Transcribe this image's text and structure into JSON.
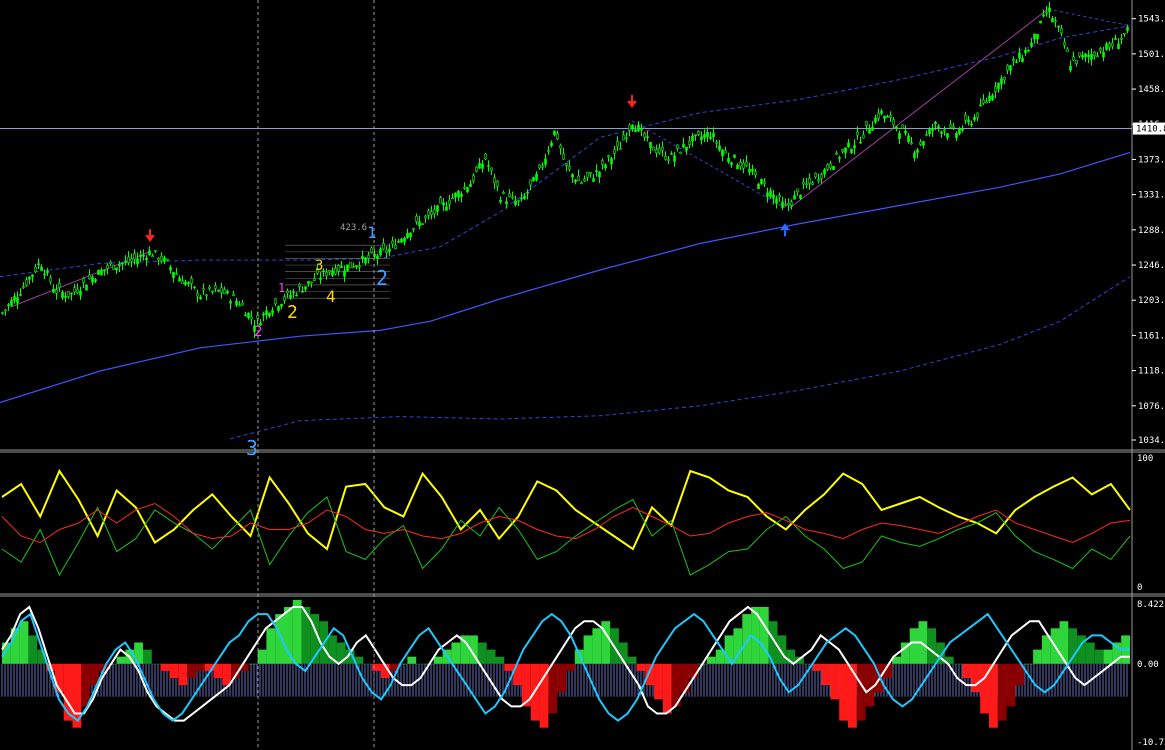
{
  "colors": {
    "background": "#000000",
    "candle_up": "#00ff00",
    "candle_down": "#00ff00",
    "ma_line": "#3a57ff",
    "band_dash": "#2f44d8",
    "hline": "#8aa0c8",
    "vline": "#9a9a9a",
    "stoch_yellow": "#ffff00",
    "stoch_green": "#19c41a",
    "stoch_red": "#ff2a1a",
    "hist_pos": "#2fd63b",
    "hist_pos_dark": "#0e8f1f",
    "hist_neg": "#ff1a1a",
    "hist_neg_dark": "#8a0000",
    "macd_white": "#ffffff",
    "macd_blue": "#1ec8ff",
    "hist_lines": "#8c9cff",
    "fib_labels": "#ffd700",
    "wave_magenta": "#ff44ff",
    "wave_cyan": "#3aa0ff",
    "arrow_red": "#ff2020",
    "arrow_blue": "#2b6bff",
    "axis_text": "#ffffff"
  },
  "price_axis": {
    "ticks": [
      "1543.5",
      "1501.0",
      "1458.5",
      "1416.0",
      "1373.5",
      "1331.0",
      "1288.5",
      "1246.0",
      "1203.5",
      "1161.0",
      "1118.5",
      "1076.0",
      "1034.7"
    ],
    "current_price_label": "1410.8"
  },
  "stoch_axis": {
    "top": "100",
    "bottom": "0"
  },
  "macd_axis": {
    "top": "8.422",
    "mid": "0.00",
    "bottom": "-10.73"
  },
  "wave_labels": {
    "wave1_top": "1",
    "wave2_right": "2",
    "wave3_sub": "3",
    "wave4_sub": "4",
    "wave2_bottom": "2",
    "wave2_yellow": "2",
    "wave1_pink": "1",
    "fib_level": "423.6",
    "stoch_wave": "3"
  },
  "chart_data": [
    {
      "type": "candlestick",
      "title": "",
      "ylim": [
        1034.7,
        1560
      ],
      "y_ticks": [
        1543.5,
        1501.0,
        1458.5,
        1416.0,
        1373.5,
        1331.0,
        1288.5,
        1246.0,
        1203.5,
        1161.0,
        1118.5,
        1076.0,
        1034.7
      ],
      "current_price": 1410.8,
      "close_path": [
        [
          0,
          1185
        ],
        [
          20,
          1215
        ],
        [
          40,
          1250
        ],
        [
          55,
          1215
        ],
        [
          70,
          1210
        ],
        [
          90,
          1230
        ],
        [
          110,
          1245
        ],
        [
          130,
          1250
        ],
        [
          150,
          1262
        ],
        [
          165,
          1250
        ],
        [
          180,
          1230
        ],
        [
          200,
          1210
        ],
        [
          220,
          1215
        ],
        [
          240,
          1200
        ],
        [
          255,
          1175
        ],
        [
          270,
          1195
        ],
        [
          290,
          1210
        ],
        [
          310,
          1225
        ],
        [
          330,
          1240
        ],
        [
          350,
          1245
        ],
        [
          370,
          1255
        ],
        [
          390,
          1265
        ],
        [
          410,
          1290
        ],
        [
          430,
          1305
        ],
        [
          450,
          1325
        ],
        [
          470,
          1345
        ],
        [
          485,
          1375
        ],
        [
          500,
          1330
        ],
        [
          520,
          1320
        ],
        [
          540,
          1360
        ],
        [
          555,
          1410
        ],
        [
          565,
          1365
        ],
        [
          580,
          1345
        ],
        [
          600,
          1360
        ],
        [
          620,
          1390
        ],
        [
          632,
          1420
        ],
        [
          650,
          1390
        ],
        [
          670,
          1375
        ],
        [
          690,
          1395
        ],
        [
          710,
          1405
        ],
        [
          725,
          1380
        ],
        [
          745,
          1365
        ],
        [
          765,
          1340
        ],
        [
          785,
          1315
        ],
        [
          800,
          1335
        ],
        [
          820,
          1355
        ],
        [
          840,
          1380
        ],
        [
          860,
          1400
        ],
        [
          880,
          1430
        ],
        [
          900,
          1410
        ],
        [
          915,
          1385
        ],
        [
          935,
          1415
        ],
        [
          955,
          1405
        ],
        [
          975,
          1425
        ],
        [
          995,
          1460
        ],
        [
          1010,
          1485
        ],
        [
          1030,
          1510
        ],
        [
          1048,
          1555
        ],
        [
          1060,
          1525
        ],
        [
          1070,
          1490
        ],
        [
          1090,
          1500
        ],
        [
          1110,
          1510
        ],
        [
          1130,
          1530
        ]
      ],
      "ma_path": [
        [
          0,
          1080
        ],
        [
          100,
          1118
        ],
        [
          200,
          1146
        ],
        [
          300,
          1160
        ],
        [
          380,
          1167
        ],
        [
          430,
          1178
        ],
        [
          500,
          1205
        ],
        [
          600,
          1240
        ],
        [
          700,
          1272
        ],
        [
          800,
          1296
        ],
        [
          900,
          1318
        ],
        [
          1000,
          1340
        ],
        [
          1060,
          1356
        ],
        [
          1130,
          1382
        ]
      ],
      "upper_band_path": [
        [
          0,
          1232
        ],
        [
          100,
          1248
        ],
        [
          200,
          1252
        ],
        [
          300,
          1252
        ],
        [
          380,
          1254
        ],
        [
          440,
          1268
        ],
        [
          500,
          1310
        ],
        [
          600,
          1400
        ],
        [
          700,
          1430
        ],
        [
          800,
          1446
        ],
        [
          900,
          1470
        ],
        [
          1000,
          1498
        ],
        [
          1060,
          1520
        ],
        [
          1130,
          1535
        ]
      ],
      "lower_band_path": [
        [
          230,
          1036
        ],
        [
          300,
          1058
        ],
        [
          400,
          1063
        ],
        [
          500,
          1060
        ],
        [
          600,
          1064
        ],
        [
          700,
          1076
        ],
        [
          800,
          1095
        ],
        [
          900,
          1118
        ],
        [
          1000,
          1150
        ],
        [
          1060,
          1178
        ],
        [
          1130,
          1232
        ]
      ],
      "wave_markers": [
        "1",
        "2",
        "3",
        "4",
        "2"
      ],
      "fib_level_label": "423.6"
    },
    {
      "type": "line",
      "title": "",
      "ylim": [
        0,
        100
      ],
      "series": [
        {
          "color": "#ffff00",
          "values": [
            70,
            80,
            55,
            90,
            68,
            40,
            75,
            62,
            35,
            45,
            60,
            72,
            55,
            40,
            85,
            65,
            42,
            30,
            78,
            80,
            62,
            55,
            88,
            70,
            45,
            60,
            38,
            55,
            82,
            75,
            60,
            50,
            40,
            30,
            62,
            48,
            90,
            85,
            75,
            70,
            55,
            45,
            60,
            72,
            88,
            80,
            60,
            65,
            70,
            62,
            55,
            50,
            42,
            60,
            70,
            78,
            85,
            72,
            80,
            60
          ]
        },
        {
          "color": "#19c41a",
          "values": [
            30,
            20,
            45,
            10,
            35,
            62,
            28,
            38,
            60,
            50,
            42,
            30,
            45,
            60,
            18,
            40,
            58,
            70,
            28,
            22,
            38,
            48,
            15,
            30,
            52,
            40,
            62,
            45,
            22,
            28,
            40,
            50,
            60,
            68,
            40,
            52,
            10,
            18,
            28,
            30,
            45,
            55,
            40,
            30,
            15,
            20,
            40,
            35,
            32,
            38,
            45,
            50,
            58,
            40,
            28,
            22,
            15,
            30,
            22,
            40
          ]
        },
        {
          "color": "#ff2a1a",
          "values": [
            55,
            40,
            35,
            45,
            50,
            60,
            50,
            60,
            65,
            55,
            42,
            38,
            40,
            50,
            45,
            45,
            50,
            60,
            55,
            45,
            42,
            45,
            40,
            38,
            42,
            50,
            55,
            52,
            45,
            40,
            38,
            45,
            55,
            62,
            55,
            48,
            40,
            42,
            50,
            55,
            58,
            52,
            45,
            42,
            38,
            45,
            50,
            48,
            45,
            42,
            48,
            55,
            60,
            50,
            45,
            40,
            35,
            42,
            50,
            52
          ]
        }
      ]
    },
    {
      "type": "bar",
      "title": "",
      "ylim": [
        -10.73,
        8.422
      ],
      "series": [
        {
          "name": "",
          "values": [
            3,
            5,
            6,
            4,
            2,
            -1,
            -4,
            -8,
            -9,
            -6,
            -3,
            -1,
            0,
            1,
            2,
            3,
            2,
            0,
            -1,
            -2,
            -3,
            -2,
            -1,
            -1,
            -2,
            -3,
            -2,
            -1,
            0,
            2,
            5,
            7,
            8,
            9,
            8,
            7,
            6,
            4,
            3,
            2,
            1,
            0,
            -1,
            -2,
            -1,
            0,
            1,
            0,
            0,
            1,
            2,
            3,
            4,
            4,
            3,
            2,
            1,
            -1,
            -3,
            -6,
            -8,
            -9,
            -7,
            -4,
            -1,
            2,
            4,
            5,
            6,
            5,
            3,
            1,
            -1,
            -3,
            -5,
            -7,
            -6,
            -4,
            -2,
            0,
            1,
            2,
            4,
            5,
            7,
            8,
            8,
            6,
            4,
            2,
            1,
            0,
            -1,
            -3,
            -5,
            -8,
            -9,
            -8,
            -6,
            -4,
            -2,
            1,
            3,
            5,
            6,
            5,
            3,
            1,
            0,
            -2,
            -4,
            -7,
            -9,
            -8,
            -6,
            -3,
            0,
            2,
            4,
            5,
            6,
            5,
            4,
            3,
            2,
            2,
            3,
            4
          ]
        }
      ],
      "lines": [
        {
          "color": "#ffffff",
          "values": [
            2,
            4,
            7,
            8,
            5,
            1,
            -3,
            -5,
            -7,
            -7,
            -5,
            -2,
            0,
            2,
            1,
            -1,
            -4,
            -6,
            -7,
            -8,
            -8,
            -7,
            -6,
            -5,
            -4,
            -3,
            -1,
            1,
            3,
            5,
            6,
            7,
            8,
            8,
            6,
            3,
            1,
            0,
            1,
            3,
            4,
            2,
            0,
            -2,
            -3,
            -3,
            -2,
            0,
            2,
            3,
            4,
            3,
            1,
            -1,
            -3,
            -5,
            -6,
            -6,
            -5,
            -3,
            -1,
            1,
            3,
            5,
            6,
            6,
            5,
            3,
            1,
            -1,
            -3,
            -6,
            -7,
            -7,
            -6,
            -4,
            -2,
            0,
            2,
            4,
            6,
            7,
            8,
            7,
            5,
            3,
            1,
            0,
            1,
            2,
            4,
            3,
            2,
            0,
            -2,
            -4,
            -3,
            -1,
            1,
            2,
            3,
            3,
            2,
            1,
            0,
            -2,
            -3,
            -3,
            -2,
            0,
            2,
            4,
            5,
            6,
            6,
            4,
            2,
            0,
            -2,
            -3,
            -2,
            -1,
            0,
            1,
            1
          ]
        },
        {
          "color": "#1ec8ff",
          "values": [
            1,
            3,
            6,
            7,
            3,
            -1,
            -5,
            -7,
            -8,
            -6,
            -3,
            0,
            2,
            3,
            1,
            -2,
            -5,
            -7,
            -8,
            -7,
            -5,
            -3,
            -1,
            1,
            3,
            4,
            6,
            7,
            7,
            5,
            2,
            0,
            -1,
            1,
            3,
            5,
            4,
            1,
            -2,
            -4,
            -5,
            -3,
            0,
            2,
            4,
            5,
            3,
            1,
            -1,
            -3,
            -5,
            -7,
            -6,
            -4,
            -1,
            2,
            4,
            6,
            7,
            6,
            4,
            1,
            -2,
            -5,
            -7,
            -8,
            -7,
            -5,
            -2,
            1,
            3,
            5,
            6,
            7,
            6,
            4,
            2,
            0,
            2,
            4,
            3,
            1,
            -2,
            -4,
            -3,
            -1,
            1,
            3,
            4,
            5,
            4,
            2,
            0,
            -3,
            -5,
            -6,
            -5,
            -3,
            -1,
            1,
            3,
            4,
            5,
            6,
            7,
            5,
            3,
            1,
            -1,
            -3,
            -4,
            -3,
            -1,
            1,
            3,
            4,
            4,
            3,
            2,
            2
          ]
        }
      ]
    }
  ]
}
